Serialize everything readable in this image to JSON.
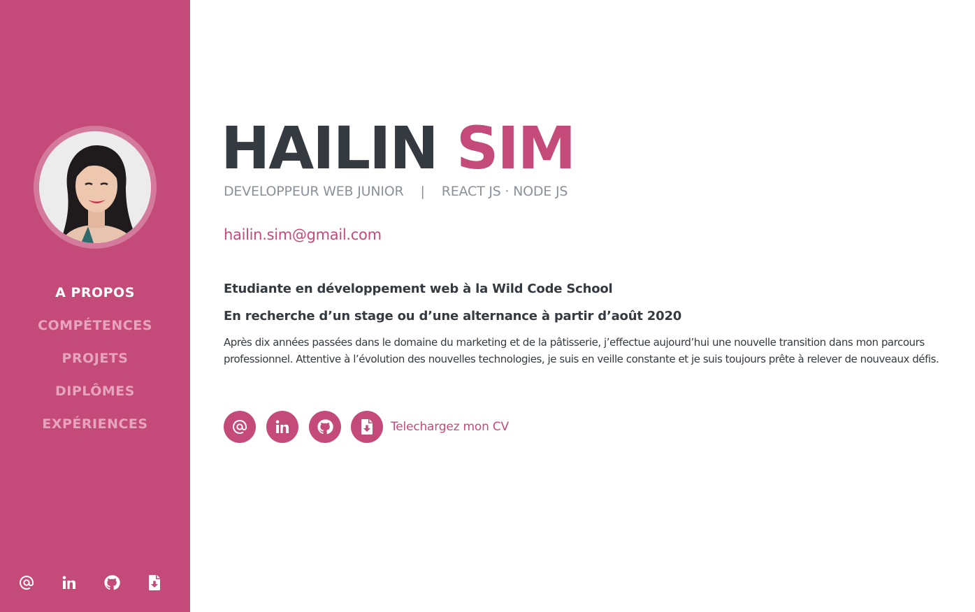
{
  "sidebar": {
    "nav": [
      {
        "label": "A PROPOS",
        "active": true
      },
      {
        "label": "COMPÉTENCES",
        "active": false
      },
      {
        "label": "PROJETS",
        "active": false
      },
      {
        "label": "DIPLÔMES",
        "active": false
      },
      {
        "label": "EXPÉRIENCES",
        "active": false
      }
    ],
    "icons": [
      "at-icon",
      "linkedin-icon",
      "github-icon",
      "file-download-icon"
    ]
  },
  "hero": {
    "first_name": "HAILIN",
    "last_name": "SIM",
    "role": "DEVELOPPEUR WEB JUNIOR",
    "separator": "|",
    "stack": "REACT JS · NODE JS",
    "email": "hailin.sim@gmail.com"
  },
  "about": {
    "lead1": "Etudiante en développement web à la Wild Code School",
    "lead2": "En recherche d’un stage ou d’une alternance à partir d’août 2020",
    "description": "Après dix années passées dans le domaine du marketing et de la pâtisserie, j’effectue aujourd’hui une nouvelle transition dans mon parcours professionnel. Attentive à l’évolution des nouvelles technologies, je suis en veille constante et je suis toujours prête à relever de nouveaux défis."
  },
  "social": {
    "icons": [
      "at-icon",
      "linkedin-icon",
      "github-icon",
      "file-download-icon"
    ],
    "cv_label": "Telechargez mon CV"
  },
  "colors": {
    "accent": "#c44b79",
    "nav_inactive": "#e6a4bd",
    "dark_text": "#343a40",
    "muted_text": "#8a919a"
  }
}
